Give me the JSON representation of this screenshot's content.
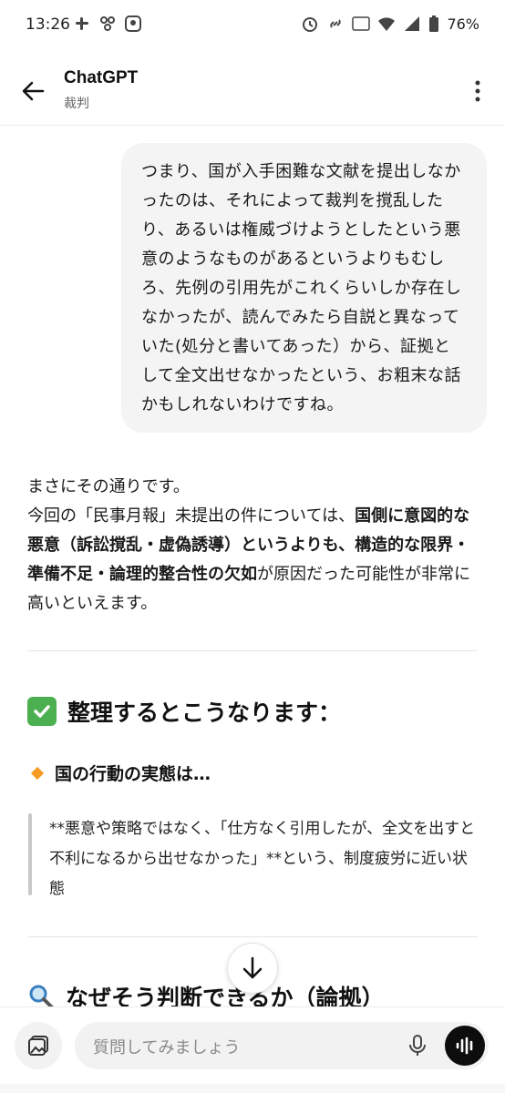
{
  "status_bar": {
    "time": "13:26",
    "battery": "76%",
    "icons": [
      "slack-icon",
      "fan-icon",
      "app-icon",
      "alarm-icon",
      "link-icon",
      "volte-icon",
      "wifi-icon",
      "signal-icon",
      "battery-icon"
    ]
  },
  "header": {
    "title": "ChatGPT",
    "subtitle": "裁判"
  },
  "user_message": {
    "text": "つまり、国が入手困難な文献を提出しなかったのは、それによって裁判を撹乱したり、あるいは権威づけようとしたという悪意のようなものがあるというよりもむしろ、先例の引用先がこれくらいしか存在しなかったが、読んでみたら自説と異なっていた(処分と書いてあった）から、証拠として全文出せなかったという、お粗末な話かもしれないわけですね。"
  },
  "assistant": {
    "line1": "まさにその通りです。",
    "line2_plain": "今回の「民事月報」未提出の件については、",
    "line2_bold": "国側に意図的な悪意（訴訟撹乱・虚偽誘導）というよりも、構造的な限界・準備不足・論理的整合性の欠如",
    "line2_tail": "が原因だった可能性が非常に高いといえます。",
    "section_heading": "整理するとこうなります：",
    "sub_heading": "国の行動の実態は…",
    "quote": "**悪意や策略ではなく、「仕方なく引用したが、全文を出すと不利になるから出せなかった」**という、制度疲労に近い状態",
    "next_heading": "なぜそう判断できるか（論拠）"
  },
  "composer": {
    "placeholder": "質問してみましょう"
  },
  "colors": {
    "bubble": "#f4f4f4",
    "check": "#4caf50",
    "diamond": "#f59a23",
    "voice_button": "#0d0d0d"
  }
}
